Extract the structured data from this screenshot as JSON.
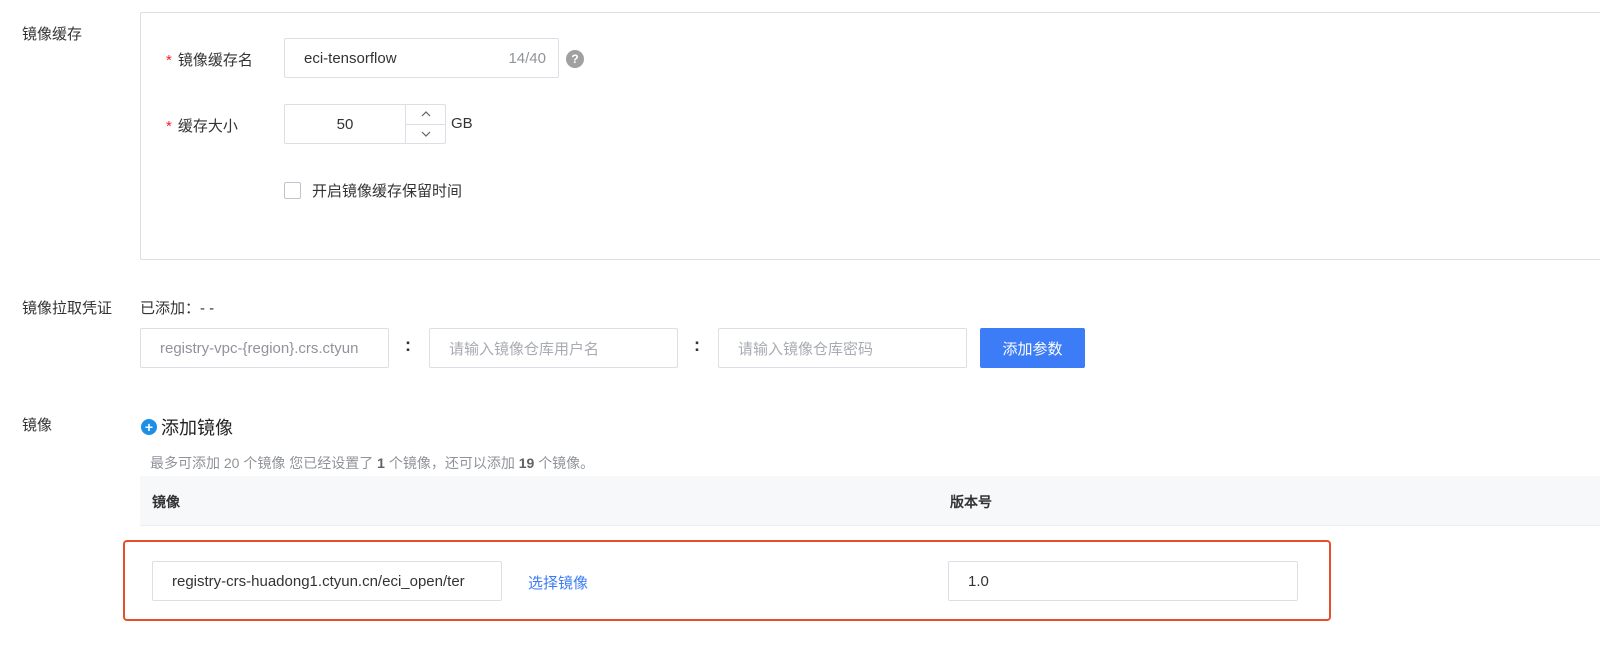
{
  "cache": {
    "section_label": "镜像缓存",
    "name_label": "镜像缓存名",
    "name_value": "eci-tensorflow",
    "name_count": "14/40",
    "size_label": "缓存大小",
    "size_value": "50",
    "size_unit": "GB",
    "retention_label": "开启镜像缓存保留时间",
    "retention_checked": false,
    "required_mark": "*"
  },
  "credentials": {
    "section_label": "镜像拉取凭证",
    "added_text": "已添加：- -",
    "registry_value": "registry-vpc-{region}.crs.ctyun",
    "separator": ":",
    "username_placeholder": "请输入镜像仓库用户名",
    "password_placeholder": "请输入镜像仓库密码",
    "add_param_button": "添加参数"
  },
  "images": {
    "section_label": "镜像",
    "add_image_label": "添加镜像",
    "hint_prefix": "最多可添加 20 个镜像 您已经设置了",
    "hint_set_count": "1",
    "hint_middle": "个镜像，还可以添加",
    "hint_remaining": "19",
    "hint_suffix": "个镜像。",
    "table_headers": [
      "镜像",
      "版本号"
    ],
    "rows": [
      {
        "image": "registry-crs-huadong1.ctyun.cn/eci_open/ter",
        "select_label": "选择镜像",
        "version": "1.0"
      }
    ]
  },
  "icons": {
    "help": "question-circle-icon",
    "plus": "plus-circle-icon",
    "stepper_up": "chevron-up-icon",
    "stepper_down": "chevron-down-icon"
  },
  "colors": {
    "primary": "#3c7cf6",
    "required": "#f5222d",
    "highlight": "#e84e2c"
  }
}
